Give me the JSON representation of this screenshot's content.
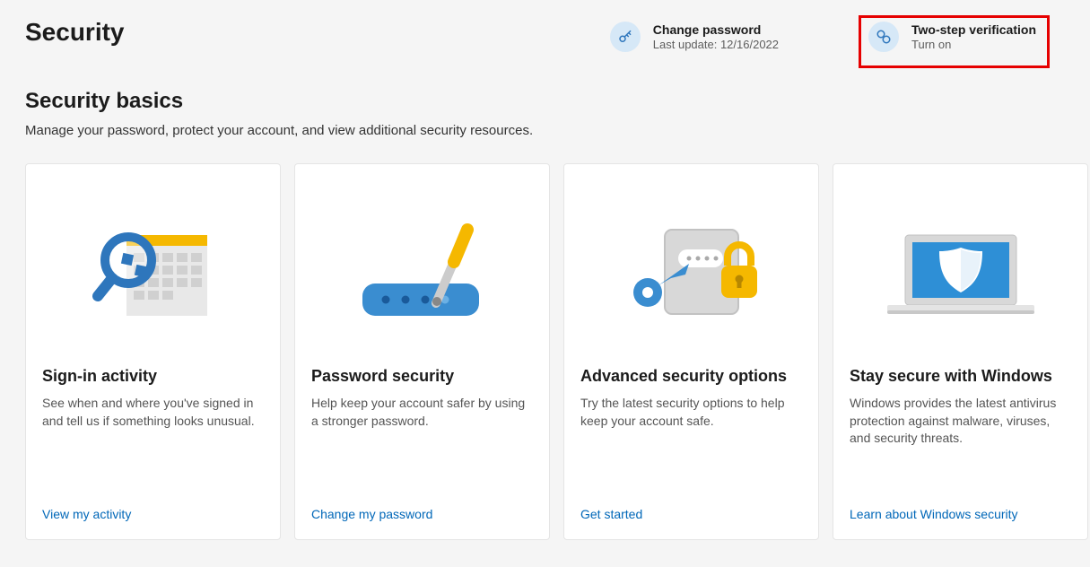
{
  "page": {
    "title": "Security",
    "section_heading": "Security basics",
    "section_sub": "Manage your password, protect your account, and view additional security resources."
  },
  "header_actions": {
    "change_password": {
      "title": "Change password",
      "sub": "Last update: 12/16/2022",
      "icon": "key-icon"
    },
    "two_step": {
      "title": "Two-step verification",
      "sub": "Turn on",
      "icon": "link-icon",
      "highlighted": true
    }
  },
  "cards": {
    "signin": {
      "title": "Sign-in activity",
      "desc": "See when and where you've signed in and tell us if something looks unusual.",
      "link": "View my activity"
    },
    "password": {
      "title": "Password security",
      "desc": "Help keep your account safer by using a stronger password.",
      "link": "Change my password"
    },
    "advanced": {
      "title": "Advanced security options",
      "desc": "Try the latest security options to help keep your account safe.",
      "link": "Get started"
    },
    "windows": {
      "title": "Stay secure with Windows",
      "desc": "Windows provides the latest antivirus protection against malware, viruses, and security threats.",
      "link": "Learn about Windows security"
    }
  },
  "colors": {
    "accent_blue": "#2e76bc",
    "accent_yellow": "#f5b800",
    "link": "#0067b8"
  }
}
